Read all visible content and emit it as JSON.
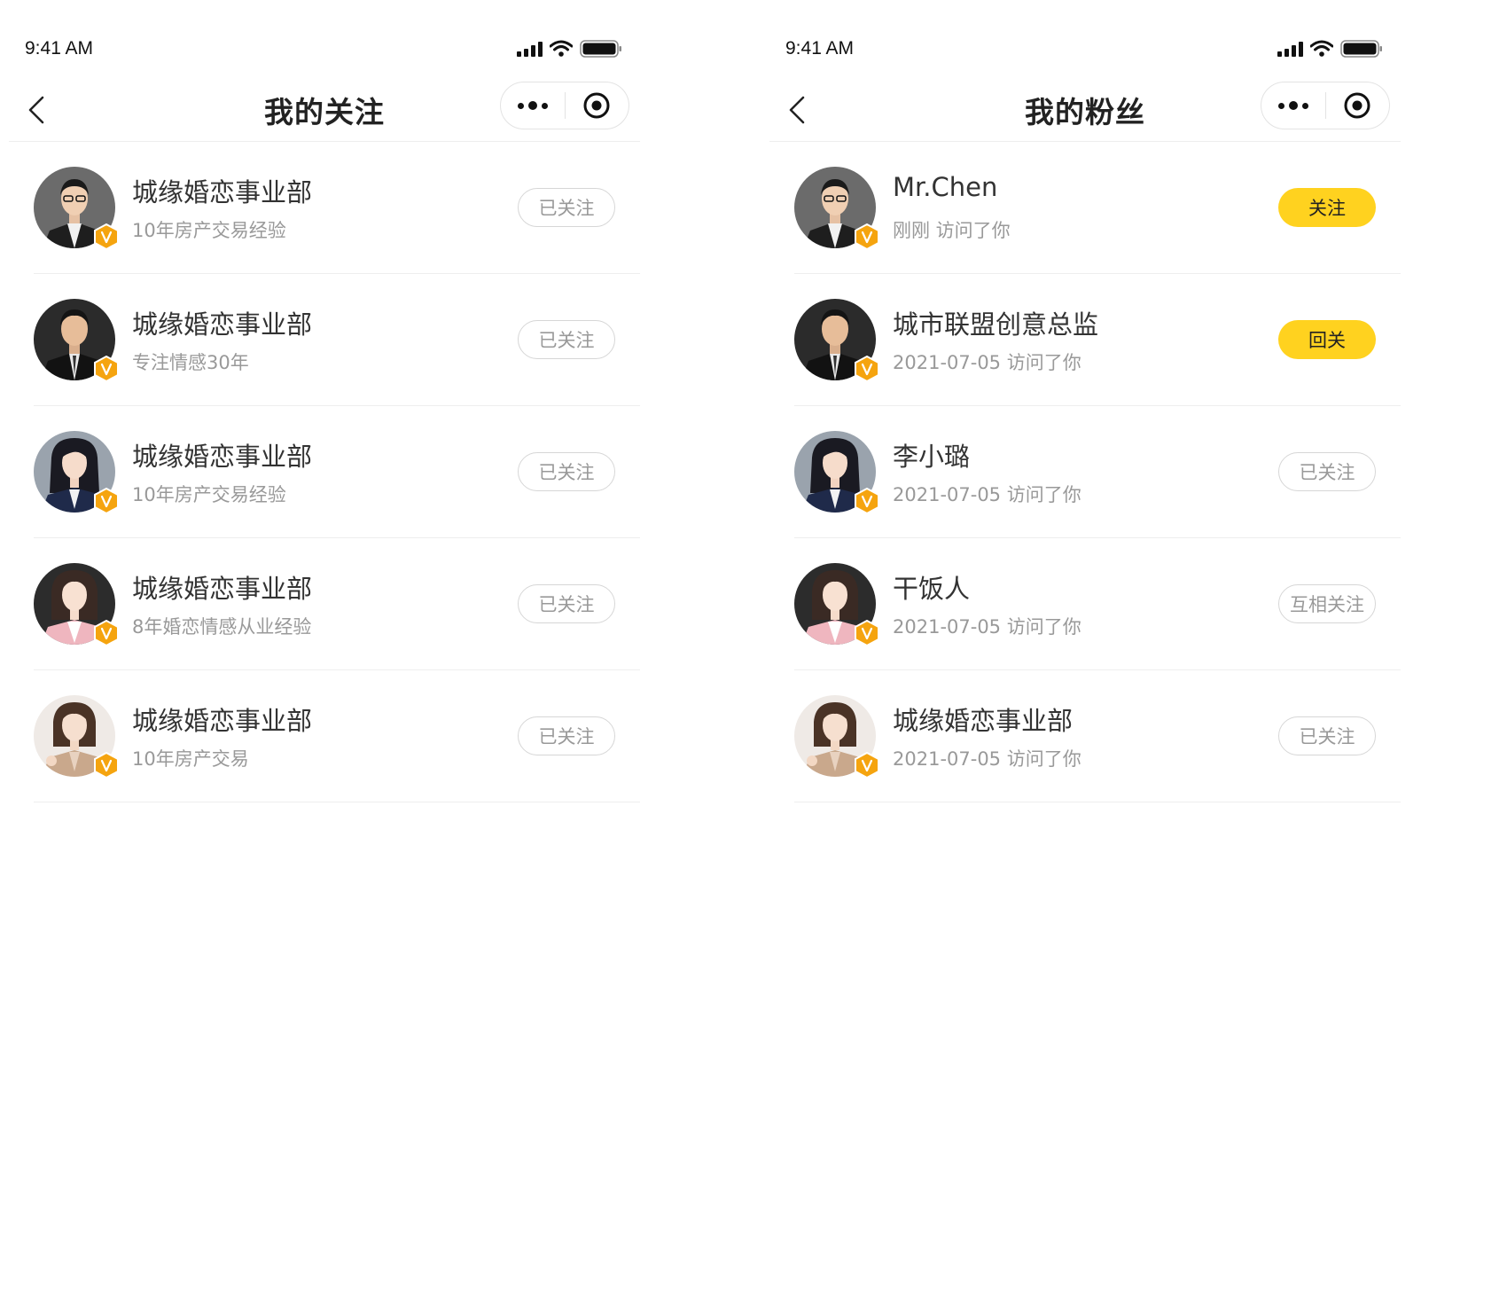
{
  "colors": {
    "accent": "#ffd21f",
    "badge": "#f5a40f",
    "divider": "#eeeeee",
    "text_primary": "#333333",
    "text_secondary": "#999999"
  },
  "screens": [
    {
      "status": {
        "time": "9:41 AM"
      },
      "title": "我的关注",
      "items": [
        {
          "name": "城缘婚恋事业部",
          "subtitle": "10年房产交易经验",
          "button": "已关注",
          "button_style": "outline",
          "avatar": "man-glasses"
        },
        {
          "name": "城缘婚恋事业部",
          "subtitle": "专注情感30年",
          "button": "已关注",
          "button_style": "outline",
          "avatar": "man-suit"
        },
        {
          "name": "城缘婚恋事业部",
          "subtitle": "10年房产交易经验",
          "button": "已关注",
          "button_style": "outline",
          "avatar": "woman-navy"
        },
        {
          "name": "城缘婚恋事业部",
          "subtitle": "8年婚恋情感从业经验",
          "button": "已关注",
          "button_style": "outline",
          "avatar": "woman-pink"
        },
        {
          "name": "城缘婚恋事业部",
          "subtitle": "10年房产交易",
          "button": "已关注",
          "button_style": "outline",
          "avatar": "woman-beige"
        }
      ]
    },
    {
      "status": {
        "time": "9:41 AM"
      },
      "title": "我的粉丝",
      "items": [
        {
          "name": "Mr.Chen",
          "subtitle": "刚刚  访问了你",
          "button": "关注",
          "button_style": "yellow",
          "avatar": "man-glasses"
        },
        {
          "name": "城市联盟创意总监",
          "subtitle": "2021-07-05  访问了你",
          "button": "回关",
          "button_style": "yellow",
          "avatar": "man-suit"
        },
        {
          "name": "李小璐",
          "subtitle": "2021-07-05  访问了你",
          "button": "已关注",
          "button_style": "outline",
          "avatar": "woman-navy"
        },
        {
          "name": "干饭人",
          "subtitle": "2021-07-05  访问了你",
          "button": "互相关注",
          "button_style": "outline",
          "avatar": "woman-pink"
        },
        {
          "name": "城缘婚恋事业部",
          "subtitle": "2021-07-05  访问了你",
          "button": "已关注",
          "button_style": "outline",
          "avatar": "woman-beige"
        }
      ]
    }
  ]
}
